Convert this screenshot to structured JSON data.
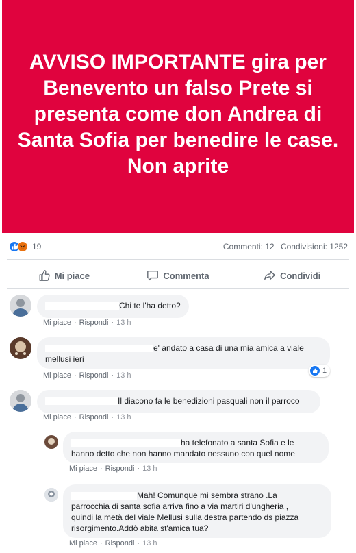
{
  "post": {
    "banner_text": "AVVISO IMPORTANTE gira per Benevento un falso Prete si presenta come don Andrea di Santa Sofia per benedire le case. Non aprite",
    "banner_color": "#e0033e"
  },
  "stats": {
    "reaction_count": "19",
    "comments": "Commenti: 12",
    "shares": "Condivisioni: 1252",
    "reaction_icons": [
      "like-icon",
      "angry-icon"
    ]
  },
  "actions": {
    "like": "Mi piace",
    "comment": "Commenta",
    "share": "Condividi"
  },
  "comments": [
    {
      "text": "Chi te l'ha detto?",
      "like": "Mi piace",
      "reply": "Rispondi",
      "time": "13 h"
    },
    {
      "text": "e' andato a casa di una mia amica a viale mellusi ieri",
      "text_line1": "e' andato a casa di una mia amica a viale",
      "text_line2": "mellusi ieri",
      "like": "Mi piace",
      "reply": "Rispondi",
      "time": "13 h",
      "likes": "1"
    },
    {
      "text": "Il diacono fa le benedizioni pasquali non il parroco",
      "like": "Mi piace",
      "reply": "Rispondi",
      "time": "13 h"
    },
    {
      "text_line1": "ha telefonato a santa Sofia e le",
      "text_line2": "hanno detto che non hanno mandato nessuno con quel nome",
      "like": "Mi piace",
      "reply": "Rispondi",
      "time": "13 h"
    },
    {
      "text_line1": "Mah! Comunque mi sembra strano .La",
      "text_line2": "parrocchia di santa sofia arriva fino a via martiri d'ungheria ,",
      "text_line3": "quindi la metà del viale Mellusi sulla destra partendo ds piazza",
      "text_line4": "risorgimento.Addò abita st'amica tua?",
      "like": "Mi piace",
      "reply": "Rispondi",
      "time": "13 h"
    }
  ]
}
